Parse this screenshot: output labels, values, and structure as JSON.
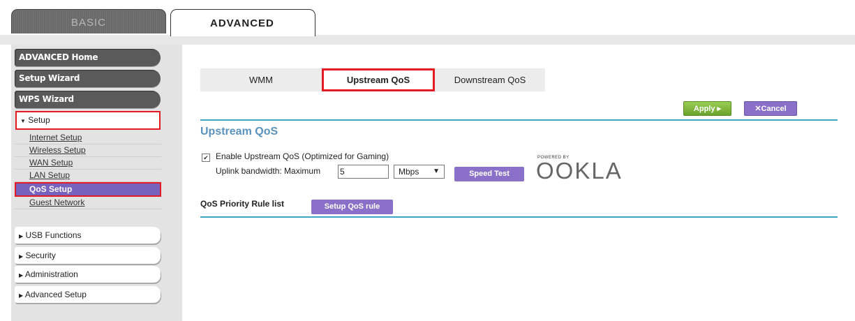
{
  "top_tabs": {
    "basic": "BASIC",
    "advanced": "ADVANCED"
  },
  "sidebar": {
    "main_items": [
      "ADVANCED Home",
      "Setup Wizard",
      "WPS Wizard"
    ],
    "setup_header": "Setup",
    "setup_items": [
      "Internet Setup",
      "Wireless Setup",
      "WAN Setup",
      "LAN Setup",
      "QoS Setup",
      "Guest Network"
    ],
    "collapsed_items": [
      "USB Functions",
      "Security",
      "Administration",
      "Advanced Setup"
    ]
  },
  "subtabs": [
    "WMM",
    "Upstream QoS",
    "Downstream QoS"
  ],
  "actions": {
    "apply": "Apply ▸",
    "cancel": "✕Cancel"
  },
  "page_title": "Upstream QoS",
  "form": {
    "enable_label": "Enable Upstream QoS (Optimized for Gaming)",
    "enable_checked": true,
    "bandwidth_label": "Uplink bandwidth: Maximum",
    "bandwidth_value": "5",
    "unit_value": "Mbps",
    "speed_test": "Speed Test"
  },
  "ookla": {
    "powered_by": "POWERED BY",
    "brand": "OOKLA"
  },
  "priority": {
    "label": "QoS Priority Rule list",
    "setup_button": "Setup QoS rule"
  },
  "colors": {
    "accent_purple": "#8a70c8",
    "highlight_red": "#e41b23",
    "rule_blue": "#3aa6c7",
    "apply_green": "#7fb840"
  }
}
